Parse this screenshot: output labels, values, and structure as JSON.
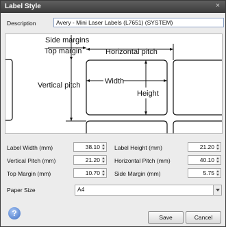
{
  "window": {
    "title": "Label Style",
    "close_glyph": "×"
  },
  "description": {
    "label": "Description",
    "value": "Avery - Mini Laser Labels (L7651) (SYSTEM)"
  },
  "diagram": {
    "side_margins": "Side margins",
    "top_margin": "Top margin",
    "horizontal_pitch": "Horizontal pitch",
    "vertical_pitch": "Vertical pitch",
    "width": "Width",
    "height": "Height"
  },
  "fields": {
    "label_width": {
      "label": "Label Width (mm)",
      "value": "38.10"
    },
    "label_height": {
      "label": "Label Height (mm)",
      "value": "21.20"
    },
    "vertical_pitch": {
      "label": "Vertical Pitch (mm)",
      "value": "21.20"
    },
    "horizontal_pitch": {
      "label": "Horizontal Pitch (mm)",
      "value": "40.10"
    },
    "top_margin": {
      "label": "Top Margin (mm)",
      "value": "10.70"
    },
    "side_margin": {
      "label": "Side Margin (mm)",
      "value": "5.75"
    }
  },
  "paper_size": {
    "label": "Paper Size",
    "value": "A4"
  },
  "buttons": {
    "help": "?",
    "save": "Save",
    "cancel": "Cancel"
  },
  "icons": {
    "help": "help-icon",
    "close": "close-icon"
  }
}
